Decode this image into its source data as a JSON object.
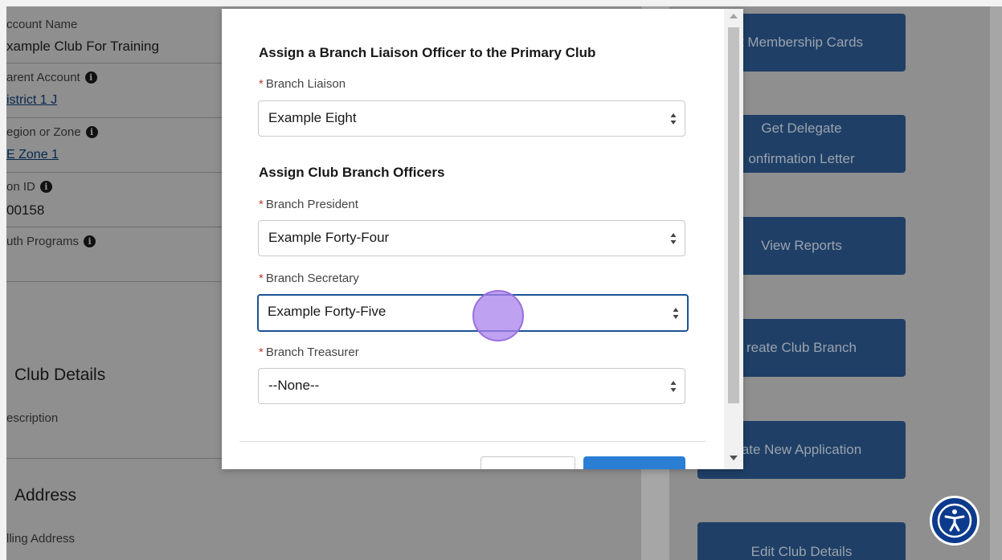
{
  "record": {
    "account_name_label": "ccount Name",
    "account_name_value": "xample Club For Training",
    "parent_account_label": "arent Account",
    "parent_account_value": "istrict 1 J",
    "region_label": "egion or Zone",
    "region_value": "E Zone 1",
    "lion_id_label": "on ID",
    "lion_id_value": "00158",
    "youth_programs_label": "uth Programs",
    "info_glyph": "i"
  },
  "sections": {
    "club_details_title": "Club Details",
    "description_label": "escription",
    "address_title": "Address",
    "billing_address_label": "lling Address"
  },
  "side_buttons": {
    "membership_cards": "t Membership Cards",
    "get_delegate_line1": "Get Delegate",
    "get_delegate_line2": "onfirmation Letter",
    "view_reports": "View Reports",
    "create_club_branch": "reate Club Branch",
    "create_new_application": "ate New Application",
    "edit_club_details": "Edit Club Details"
  },
  "modal": {
    "liaison_heading": "Assign a Branch Liaison Officer to the Primary Club",
    "liaison_label": "Branch Liaison",
    "liaison_value": "Example Eight",
    "officers_heading": "Assign Club Branch Officers",
    "president_label": "Branch President",
    "president_value": "Example Forty-Four",
    "secretary_label": "Branch Secretary",
    "secretary_value": "Example Forty-Five",
    "treasurer_label": "Branch Treasurer",
    "treasurer_value": "--None--",
    "required_marker": "*"
  },
  "icons": {
    "info": "info-icon",
    "select_arrows": "select-arrows-icon",
    "accessibility": "accessibility-icon"
  },
  "colors": {
    "side_button": "#1f3f66",
    "focus_border": "#1b5297",
    "required": "#c23934",
    "accessibility_button": "#0c3a8c"
  }
}
